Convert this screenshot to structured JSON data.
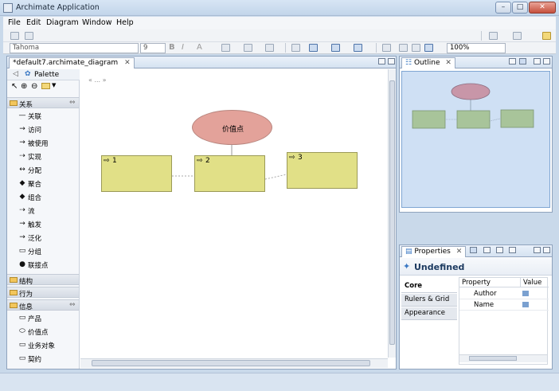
{
  "window": {
    "title": "Archimate Application",
    "controls": {
      "minimize": "–",
      "maximize": "□",
      "close": "✕"
    }
  },
  "menubar": {
    "items": [
      "File",
      "Edit",
      "Diagram",
      "Window",
      "Help"
    ]
  },
  "toolbar": {
    "font_name": "Tahoma",
    "font_size": "9",
    "bold": "B",
    "italic": "I",
    "text_color": "A",
    "zoom": "100%"
  },
  "editor": {
    "tab_title": "*default7.archimate_diagram",
    "tab_close": "✕"
  },
  "palette": {
    "title": "Palette",
    "sections": {
      "relations": {
        "label": "关系",
        "items": [
          {
            "icon": "—",
            "label": "关联"
          },
          {
            "icon": "→",
            "label": "访问"
          },
          {
            "icon": "→",
            "label": "被使用"
          },
          {
            "icon": "⇢",
            "label": "实现"
          },
          {
            "icon": "↔",
            "label": "分配"
          },
          {
            "icon": "◆",
            "label": "聚合"
          },
          {
            "icon": "◆",
            "label": "组合"
          },
          {
            "icon": "⇢",
            "label": "流"
          },
          {
            "icon": "→",
            "label": "触发"
          },
          {
            "icon": "→",
            "label": "泛化"
          },
          {
            "icon": "▭",
            "label": "分组"
          },
          {
            "icon": "●",
            "label": "联接点"
          }
        ]
      },
      "structure": {
        "label": "结构"
      },
      "behavior": {
        "label": "行为"
      },
      "information": {
        "label": "信息",
        "items": [
          {
            "icon": "▭",
            "label": "产品"
          },
          {
            "icon": "⬭",
            "label": "价值点"
          },
          {
            "icon": "▭",
            "label": "业务对象"
          },
          {
            "icon": "▭",
            "label": "契约"
          }
        ]
      }
    }
  },
  "diagram": {
    "placeholder_text": "« ... »",
    "value_element": "价值点",
    "elements": [
      {
        "number": "1"
      },
      {
        "number": "2"
      },
      {
        "number": "3"
      }
    ],
    "colors": {
      "value": "#e3a29a",
      "element": "#e1e087"
    }
  },
  "outline": {
    "tab_title": "Outline",
    "tab_close": "✕"
  },
  "properties": {
    "tab_title": "Properties",
    "tab_close": "✕",
    "header_title": "Undefined",
    "tabs": [
      "Core",
      "Rulers & Grid",
      "Appearance"
    ],
    "selected_tab": "Core",
    "columns": [
      "Property",
      "Value"
    ],
    "rows": [
      {
        "property": "Author",
        "value": ""
      },
      {
        "property": "Name",
        "value": ""
      }
    ]
  }
}
